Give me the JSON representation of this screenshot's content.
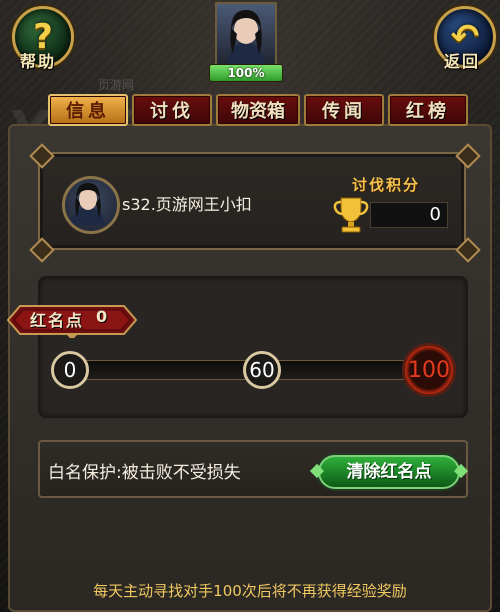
{
  "top": {
    "help_label": "帮助",
    "back_label": "返回",
    "hp_percent_text": "100%",
    "hp_fraction": 1.0
  },
  "tabs": [
    {
      "label": "信息",
      "active": true
    },
    {
      "label": "讨伐",
      "active": false
    },
    {
      "label": "物资箱",
      "active": false
    },
    {
      "label": "传闻",
      "active": false
    },
    {
      "label": "红榜",
      "active": false
    }
  ],
  "info": {
    "player_name": "s32.页游网王小扣",
    "score_title": "讨伐积分",
    "score_value": "0"
  },
  "red_points": {
    "label": "红名点",
    "value": "0",
    "milestones": [
      "0",
      "60",
      "100"
    ],
    "fill_fraction": 0
  },
  "protection": {
    "text": "白名保护:被击败不受损失",
    "clear_button": "清除红名点"
  },
  "footer_note": "每天主动寻找对手100次后将不再获得经验奖励",
  "watermark": {
    "brand": "YOYU",
    "site": "页游网"
  },
  "colors": {
    "tab_active": "#f2b24c",
    "tab_inactive": "#6a0d0d",
    "score_title": "#f2c24c",
    "clear_button": "#2fb03a",
    "footer_text": "#f0c860",
    "red_node": "#e53a1e"
  }
}
